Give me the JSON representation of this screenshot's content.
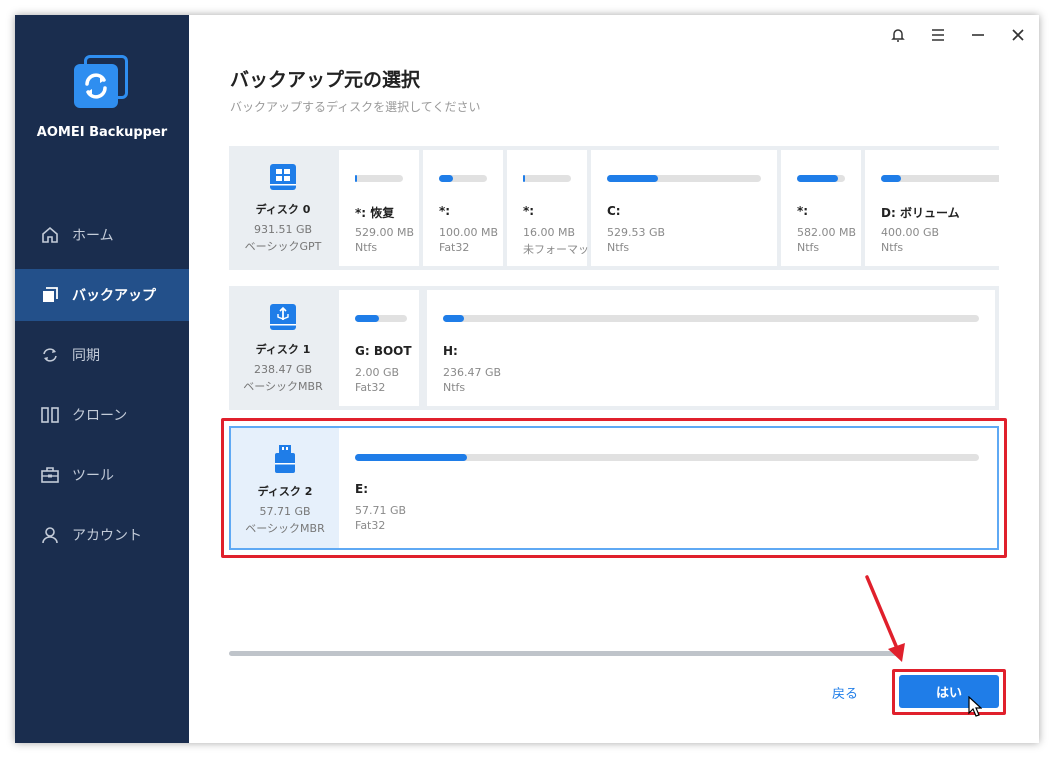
{
  "app": {
    "name": "AOMEI Backupper"
  },
  "titlebar": {
    "bell": "bell-icon",
    "menu": "menu-icon",
    "minimize": "minimize-icon",
    "close": "close-icon"
  },
  "sidebar": {
    "items": [
      {
        "label": "ホーム",
        "icon": "home-icon",
        "active": false
      },
      {
        "label": "バックアップ",
        "icon": "backup-icon",
        "active": true
      },
      {
        "label": "同期",
        "icon": "sync-icon",
        "active": false
      },
      {
        "label": "クローン",
        "icon": "clone-icon",
        "active": false
      },
      {
        "label": "ツール",
        "icon": "tools-icon",
        "active": false
      },
      {
        "label": "アカウント",
        "icon": "account-icon",
        "active": false
      }
    ]
  },
  "page": {
    "title": "バックアップ元の選択",
    "subtitle": "バックアップするディスクを選択してください"
  },
  "disks": [
    {
      "name": "ディスク 0",
      "size": "931.51 GB",
      "type": "ベーシックGPT",
      "icon": "windows-disk-icon",
      "partitions": [
        {
          "label": "*: 恢复",
          "size": "529.00 MB",
          "fs": "Ntfs",
          "used": 0.05
        },
        {
          "label": "*:",
          "size": "100.00 MB",
          "fs": "Fat32",
          "used": 0.3
        },
        {
          "label": "*:",
          "size": "16.00 MB",
          "fs": "未フォーマット",
          "used": 0.05
        },
        {
          "label": "C:",
          "size": "529.53 GB",
          "fs": "Ntfs",
          "used": 0.33
        },
        {
          "label": "*:",
          "size": "582.00 MB",
          "fs": "Ntfs",
          "used": 0.85
        },
        {
          "label": "D: ボリューム",
          "size": "400.00 GB",
          "fs": "Ntfs",
          "used": 0.15
        }
      ]
    },
    {
      "name": "ディスク 1",
      "size": "238.47 GB",
      "type": "ベーシックMBR",
      "icon": "usb-disk-icon",
      "partitions": [
        {
          "label": "G: BOOT",
          "size": "2.00 GB",
          "fs": "Fat32",
          "used": 0.47
        },
        {
          "label": "H:",
          "size": "236.47 GB",
          "fs": "Ntfs",
          "used": 0.01
        }
      ]
    },
    {
      "name": "ディスク 2",
      "size": "57.71 GB",
      "type": "ベーシックMBR",
      "icon": "usb-drive-icon",
      "partitions": [
        {
          "label": "E:",
          "size": "57.71 GB",
          "fs": "Fat32",
          "used": 0.18
        }
      ]
    }
  ],
  "footer": {
    "back_label": "戻る",
    "yes_label": "はい"
  },
  "colors": {
    "sidebar": "#1a2d4e",
    "accent": "#1f7de8",
    "highlight": "#e0202c"
  }
}
